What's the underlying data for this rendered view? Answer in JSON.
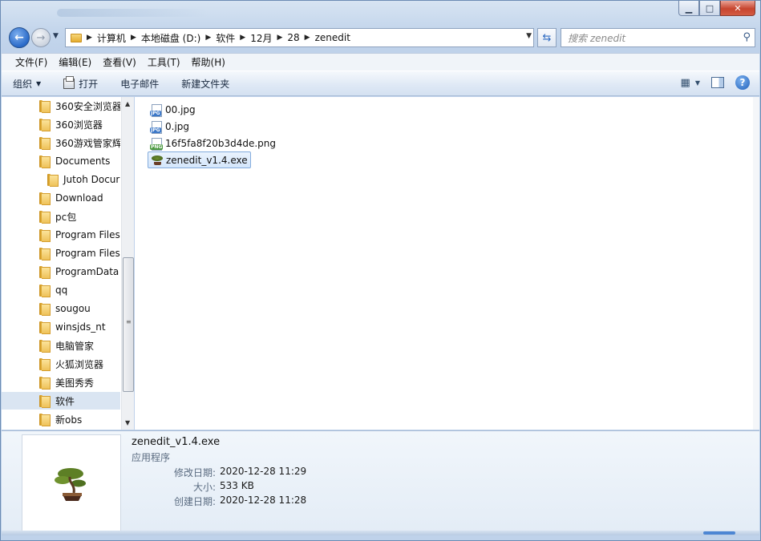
{
  "nav": {
    "path": [
      "计算机",
      "本地磁盘 (D:)",
      "软件",
      "12月",
      "28",
      "zenedit"
    ],
    "search_placeholder": "搜索 zenedit"
  },
  "menu": [
    "文件(F)",
    "编辑(E)",
    "查看(V)",
    "工具(T)",
    "帮助(H)"
  ],
  "toolbar": {
    "organize": "组织",
    "open": "打开",
    "email": "电子邮件",
    "new_folder": "新建文件夹"
  },
  "tree": [
    {
      "label": "360安全浏览器",
      "indent": 0
    },
    {
      "label": "360浏览器",
      "indent": 0
    },
    {
      "label": "360游戏管家辉",
      "indent": 0
    },
    {
      "label": "Documents",
      "indent": 0
    },
    {
      "label": "Jutoh Docur",
      "indent": 1
    },
    {
      "label": "Download",
      "indent": 0
    },
    {
      "label": "pc包",
      "indent": 0
    },
    {
      "label": "Program Files",
      "indent": 0
    },
    {
      "label": "Program Files",
      "indent": 0
    },
    {
      "label": "ProgramData",
      "indent": 0
    },
    {
      "label": "qq",
      "indent": 0
    },
    {
      "label": "sougou",
      "indent": 0
    },
    {
      "label": "winsjds_nt",
      "indent": 0
    },
    {
      "label": "电脑管家",
      "indent": 0
    },
    {
      "label": "火狐浏览器",
      "indent": 0
    },
    {
      "label": "美图秀秀",
      "indent": 0
    },
    {
      "label": "软件",
      "indent": 0,
      "selected": true
    },
    {
      "label": "新obs",
      "indent": 0
    }
  ],
  "files": [
    {
      "name": "00.jpg",
      "type": "jpg",
      "badge": "JPG"
    },
    {
      "name": "0.jpg",
      "type": "jpg",
      "badge": "JPG"
    },
    {
      "name": "16f5fa8f20b3d4de.png",
      "type": "png",
      "badge": "PNG"
    },
    {
      "name": "zenedit_v1.4.exe",
      "type": "exe",
      "selected": true
    }
  ],
  "details": {
    "name": "zenedit_v1.4.exe",
    "type": "应用程序",
    "rows": [
      {
        "label": "修改日期:",
        "value": "2020-12-28 11:29"
      },
      {
        "label": "大小:",
        "value": "533 KB"
      },
      {
        "label": "创建日期:",
        "value": "2020-12-28 11:28"
      }
    ]
  }
}
